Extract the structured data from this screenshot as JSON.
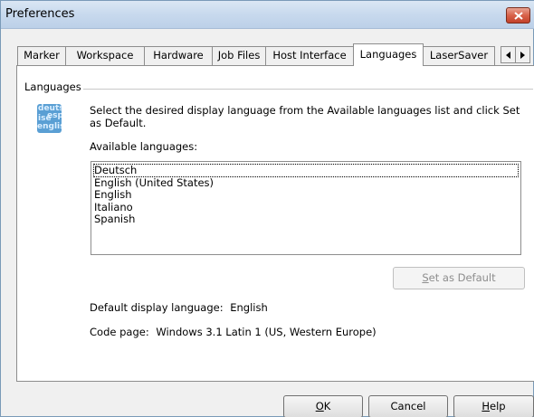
{
  "window": {
    "title": "Preferences"
  },
  "tabs": [
    {
      "label": "Marker"
    },
    {
      "label": "Workspace"
    },
    {
      "label": "Hardware"
    },
    {
      "label": "Job Files"
    },
    {
      "label": "Host Interface"
    },
    {
      "label": "Languages",
      "active": true
    },
    {
      "label": "LaserSaver"
    }
  ],
  "group": {
    "label": "Languages",
    "icon_text": [
      "deuts",
      "esp",
      "ise",
      "englis"
    ],
    "instructions": "Select the desired display language from the Available languages list and click Set as Default.",
    "available_label": "Available languages:",
    "languages": [
      "Deutsch",
      "English (United States)",
      "English",
      "Italiano",
      "Spanish"
    ],
    "focused_index": 0,
    "set_default_label": "Set as Default",
    "set_default_mnemonic": "S",
    "set_default_rest": "et as Default",
    "default_language_label": "Default display language:",
    "default_language_value": "English",
    "code_page_label": "Code page:",
    "code_page_value": "Windows 3.1 Latin 1 (US, Western Europe)"
  },
  "footer": {
    "ok_mnemonic": "O",
    "ok_rest": "K",
    "cancel_label": "Cancel",
    "help_mnemonic": "H",
    "help_rest": "elp"
  },
  "colors": {
    "title_bar": "#c9daee",
    "close_button": "#d8624a",
    "disabled_text": "#8d8d8d"
  }
}
